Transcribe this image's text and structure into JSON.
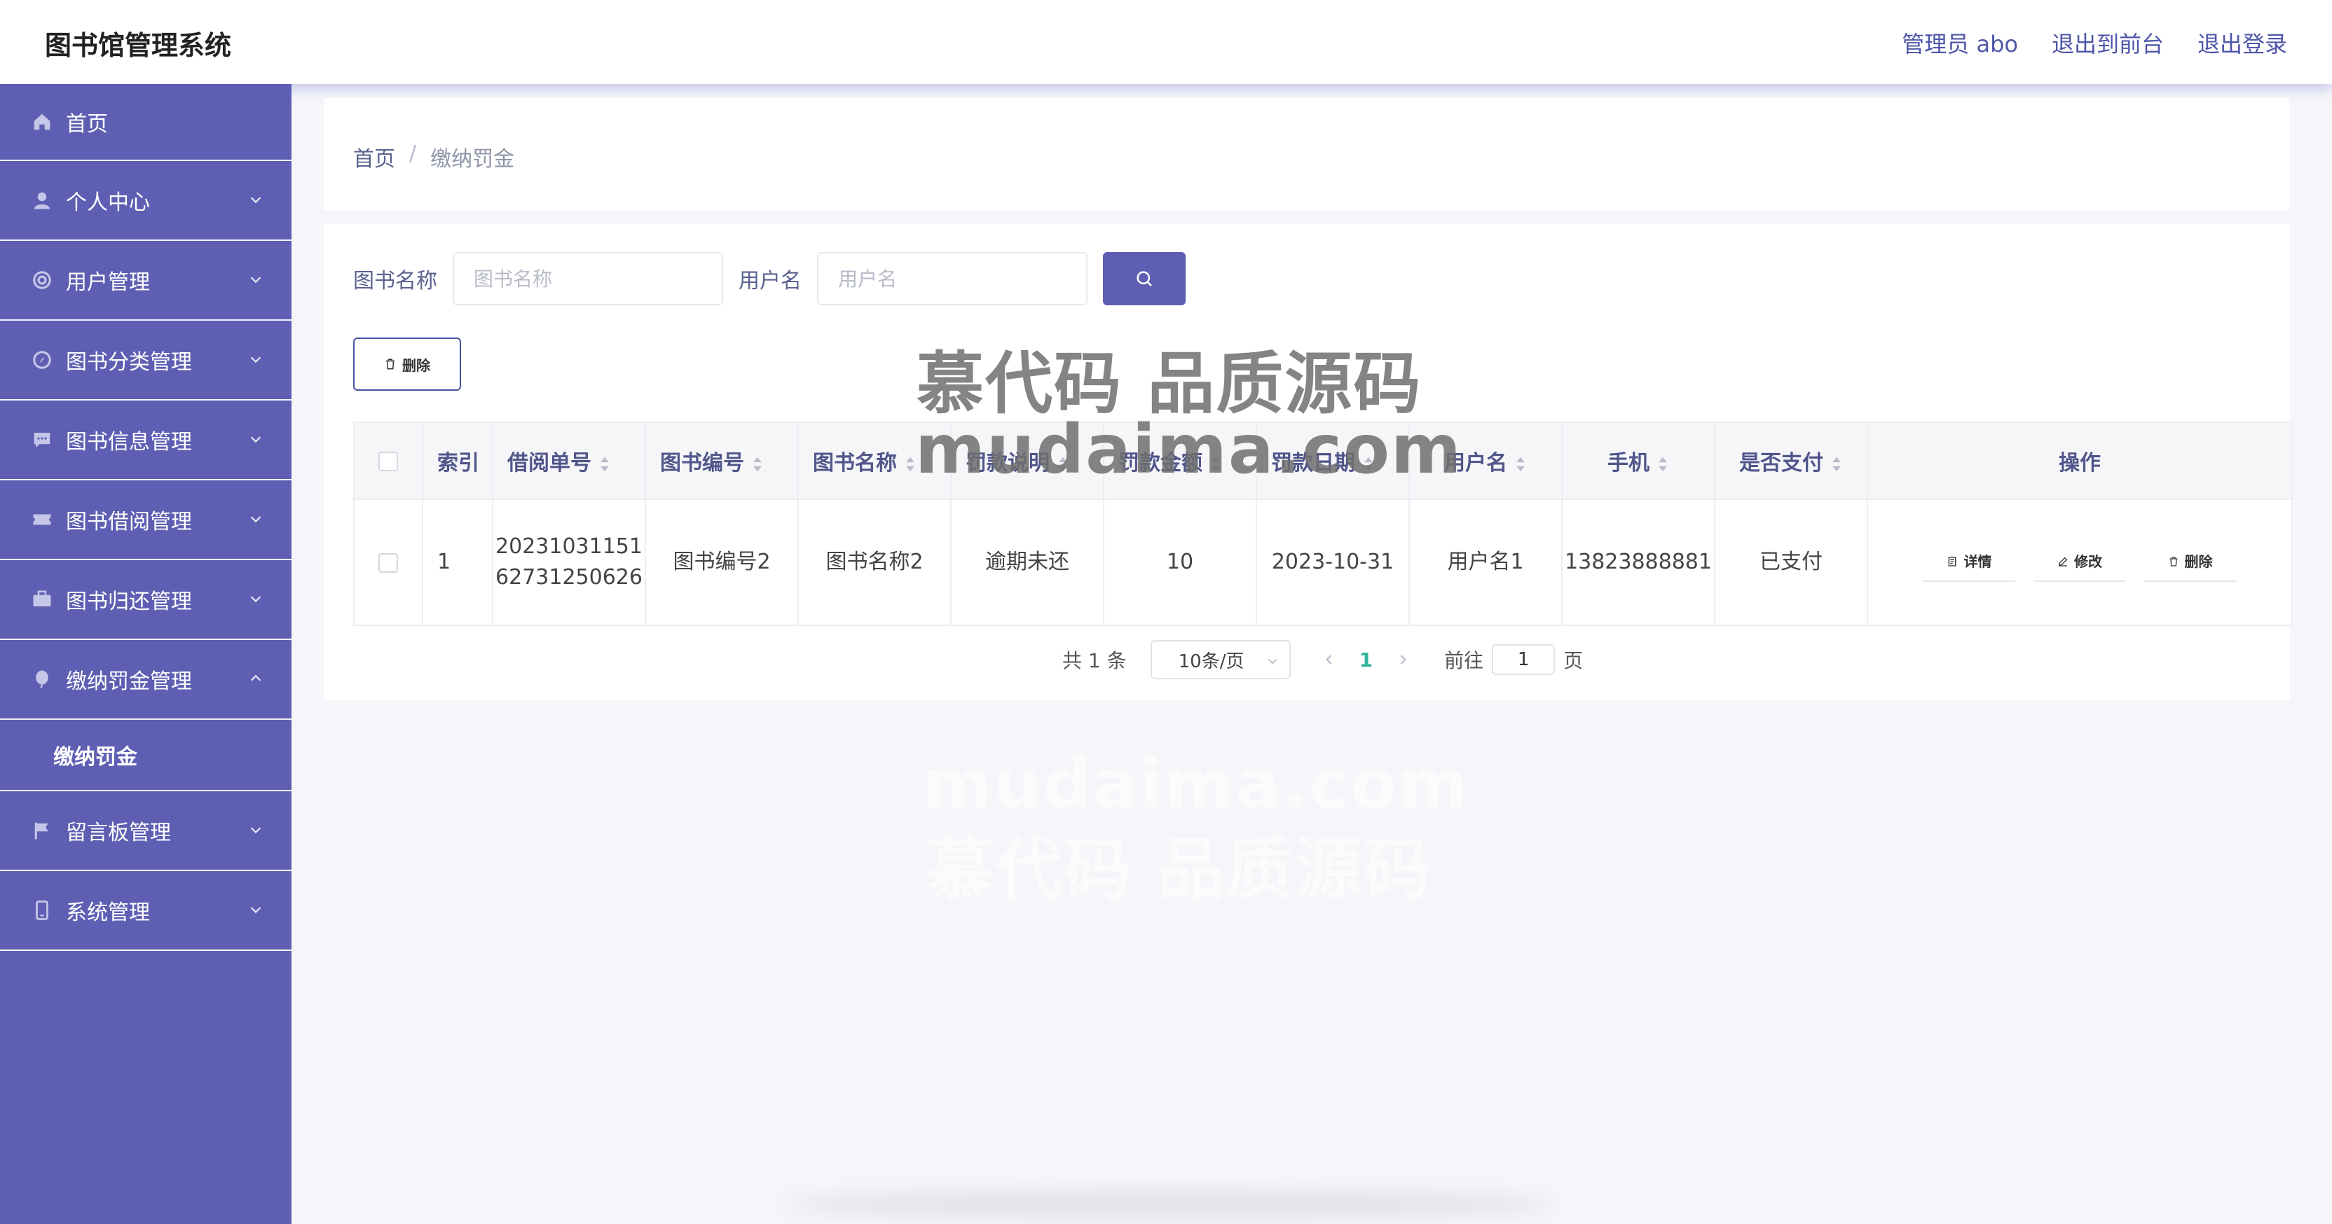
{
  "app": {
    "title": "图书馆管理系统"
  },
  "header": {
    "user": "管理员 abo",
    "to_front": "退出到前台",
    "logout": "退出登录"
  },
  "sidebar": {
    "items": [
      {
        "label": "首页",
        "icon": "home-icon"
      },
      {
        "label": "个人中心",
        "icon": "user-icon"
      },
      {
        "label": "用户管理",
        "icon": "users-icon"
      },
      {
        "label": "图书分类管理",
        "icon": "compass-icon"
      },
      {
        "label": "图书信息管理",
        "icon": "message-icon"
      },
      {
        "label": "图书借阅管理",
        "icon": "ticket-icon"
      },
      {
        "label": "图书归还管理",
        "icon": "briefcase-icon"
      },
      {
        "label": "缴纳罚金管理",
        "icon": "balloon-icon"
      },
      {
        "label": "留言板管理",
        "icon": "flag-icon"
      },
      {
        "label": "系统管理",
        "icon": "phone-icon"
      }
    ],
    "submenu": {
      "label": "缴纳罚金"
    }
  },
  "breadcrumb": {
    "home": "首页",
    "sep": "/",
    "current": "缴纳罚金"
  },
  "search": {
    "book_label": "图书名称",
    "book_placeholder": "图书名称",
    "user_label": "用户名",
    "user_placeholder": "用户名"
  },
  "toolbar": {
    "delete_label": "删除"
  },
  "table": {
    "headers": {
      "index": "索引",
      "borrow_no": "借阅单号",
      "book_no": "图书编号",
      "book_name": "图书名称",
      "fine_desc": "罚款说明",
      "fine_amount": "罚款金额",
      "fine_date": "罚款日期",
      "username": "用户名",
      "phone": "手机",
      "paid": "是否支付",
      "ops": "操作"
    },
    "rows": [
      {
        "index": "1",
        "borrow_no_l1": "20231031151",
        "borrow_no_l2": "62731250626",
        "book_no": "图书编号2",
        "book_name": "图书名称2",
        "fine_desc": "逾期未还",
        "fine_amount": "10",
        "fine_date": "2023-10-31",
        "username": "用户名1",
        "phone": "13823888881",
        "paid": "已支付"
      }
    ],
    "ops": {
      "detail": "详情",
      "edit": "修改",
      "delete": "删除"
    }
  },
  "pagination": {
    "total": "共 1 条",
    "page_size": "10条/页",
    "current_page": "1",
    "goto_label": "前往",
    "goto_value": "1",
    "page_suffix": "页"
  },
  "watermark": {
    "line1": "慕代码 品质源码",
    "line2": "mudaima.com"
  },
  "colors": {
    "sidebar_bg": "#5e5fb3",
    "accent": "#5e5fb3",
    "link": "#4d56a8",
    "active_page": "#2fb39a"
  }
}
